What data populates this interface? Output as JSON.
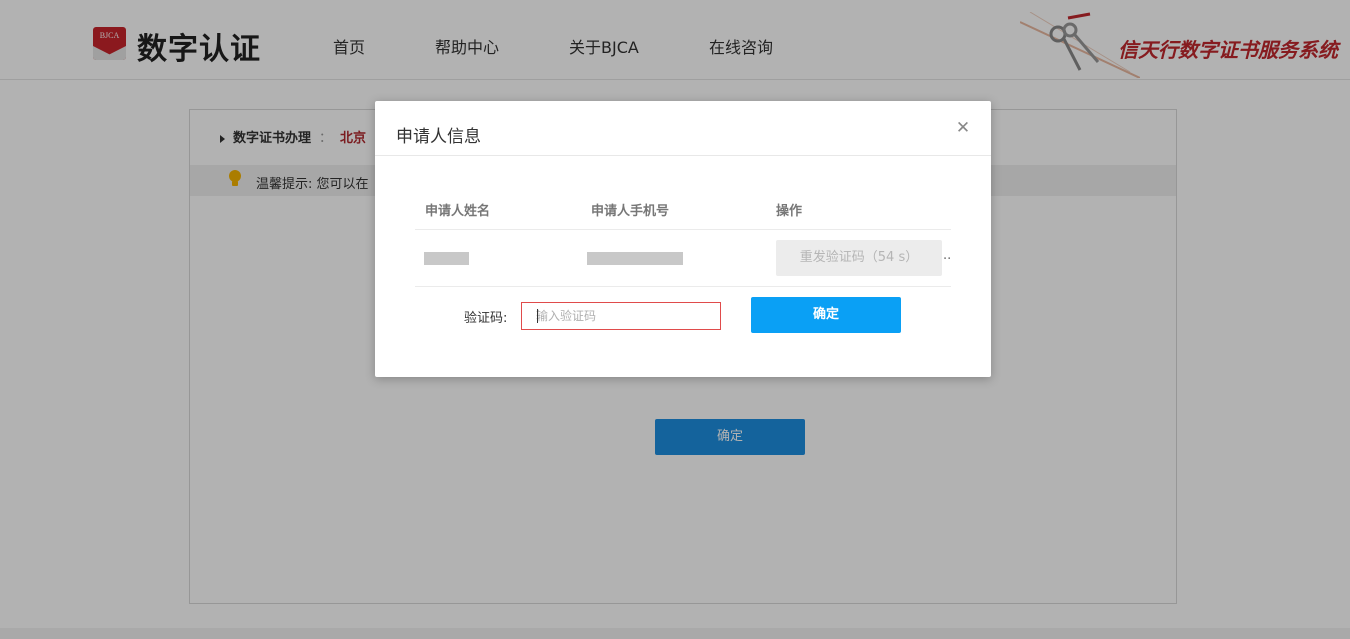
{
  "header": {
    "logo_badge": "BJCA",
    "logo_text": "数字认证",
    "nav": [
      "首页",
      "帮助中心",
      "关于BJCA",
      "在线咨询"
    ],
    "slogan": "信天行数字证书服务系统"
  },
  "main": {
    "breadcrumb_label": "数字证书办理",
    "breadcrumb_sep": "：",
    "breadcrumb_region": "北京",
    "tip_text": "温馨提示:  您可以在",
    "confirm_label": "确定"
  },
  "modal": {
    "title": "申请人信息",
    "close_icon": "close-icon",
    "columns": [
      "申请人姓名",
      "申请人手机号",
      "操作"
    ],
    "resend_label": "重发验证码（54 s）",
    "ellipsis": "..",
    "code_label": "验证码:",
    "code_placeholder": "输入验证码",
    "code_value": "",
    "confirm_label": "确定"
  },
  "colors": {
    "brand_red": "#c1272d",
    "primary_blue": "#0aa0f5",
    "error_border": "#e04b4b"
  }
}
